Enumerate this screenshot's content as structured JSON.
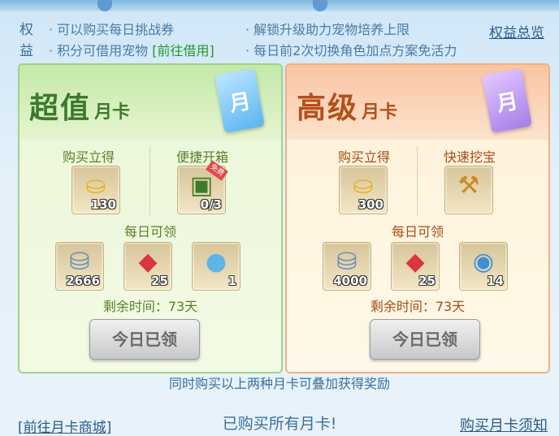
{
  "benefits": {
    "title": "权益",
    "items": [
      "· 可以购买每日挑战券",
      "· 解锁升级助力宠物培养上限",
      "· 积分可借用宠物",
      "· 每日前2次切换角色加点方案免活力"
    ],
    "link": "[前往借用]",
    "overview": "权益总览"
  },
  "cards": [
    {
      "title_main": "超值",
      "title_sub": "月卡",
      "icon_char": "月",
      "buy_label": "购买立得",
      "perk_label": "便捷开箱",
      "buy_item": {
        "icon": "gold-ingot-icon",
        "count": "130"
      },
      "perk_item": {
        "icon": "treasure-chest-icon",
        "count": "0/3",
        "badge": "免费"
      },
      "daily_label": "每日可领",
      "daily_items": [
        {
          "icon": "silver-ingot-icon",
          "count": "2666"
        },
        {
          "icon": "red-gem-icon",
          "count": "25"
        },
        {
          "icon": "blue-orb-icon",
          "count": "1"
        }
      ],
      "remain": "剩余时间：73天",
      "button": "今日已领"
    },
    {
      "title_main": "高级",
      "title_sub": "月卡",
      "icon_char": "月",
      "buy_label": "购买立得",
      "perk_label": "快速挖宝",
      "buy_item": {
        "icon": "gold-ingot-icon",
        "count": "300"
      },
      "perk_item": {
        "icon": "shovel-icon",
        "count": ""
      },
      "daily_label": "每日可领",
      "daily_items": [
        {
          "icon": "silver-ingot-icon",
          "count": "4000"
        },
        {
          "icon": "red-gem-icon",
          "count": "25"
        },
        {
          "icon": "swirl-orb-icon",
          "count": "14"
        }
      ],
      "remain": "剩余时间：73天",
      "button": "今日已领"
    }
  ],
  "note": "同时购买以上两种月卡可叠加获得奖励",
  "footer": {
    "shop_link": "[前往月卡商城]",
    "status": "已购买所有月卡!",
    "notice": "购买月卡须知"
  }
}
